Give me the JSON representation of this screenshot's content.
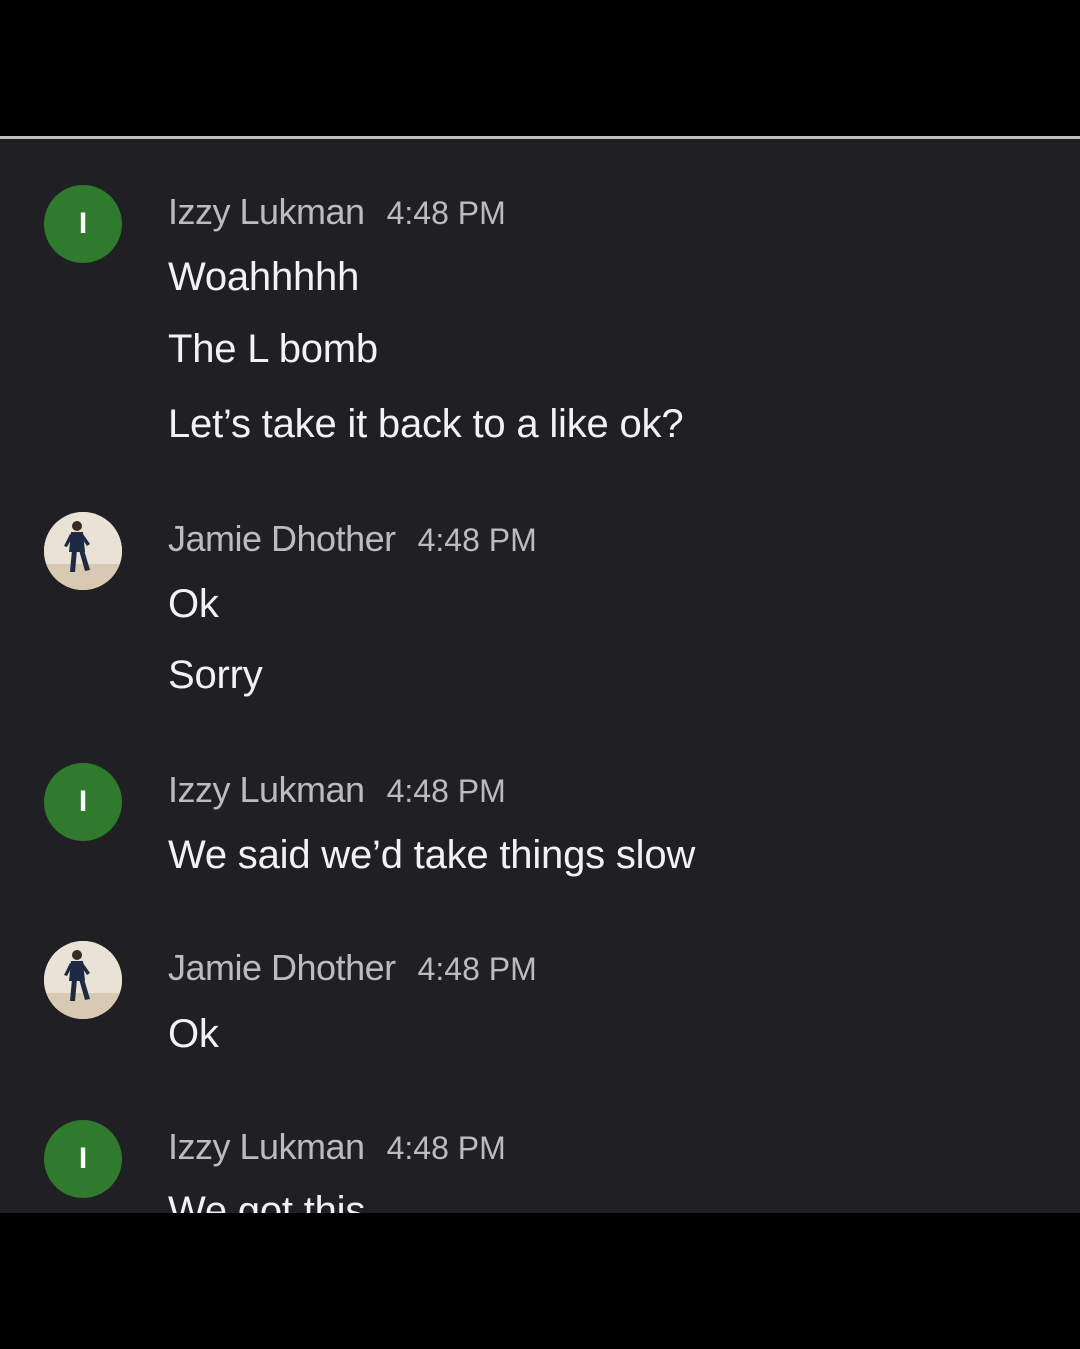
{
  "messages": [
    {
      "sender": "Izzy Lukman",
      "avatar_letter": "I",
      "time": "4:48 PM",
      "lines": [
        "Woahhhhh",
        "The L bomb",
        "Let’s take it back to a like ok?"
      ]
    },
    {
      "sender": "Jamie Dhother",
      "avatar_letter": "",
      "time": "4:48 PM",
      "lines": [
        "Ok",
        "Sorry"
      ]
    },
    {
      "sender": "Izzy Lukman",
      "avatar_letter": "I",
      "time": "4:48 PM",
      "lines": [
        "We said we’d take things slow"
      ]
    },
    {
      "sender": "Jamie Dhother",
      "avatar_letter": "",
      "time": "4:48 PM",
      "lines": [
        "Ok"
      ]
    },
    {
      "sender": "Izzy Lukman",
      "avatar_letter": "I",
      "time": "4:48 PM",
      "lines": [
        "We got this"
      ]
    }
  ],
  "colors": {
    "chat_background": "#202024",
    "avatar_green": "#2f7a2c",
    "name_grey": "#bcbcbc",
    "text_white": "#f2f2f2"
  },
  "icons": {
    "jamie_avatar": "person-photo-avatar-icon"
  }
}
